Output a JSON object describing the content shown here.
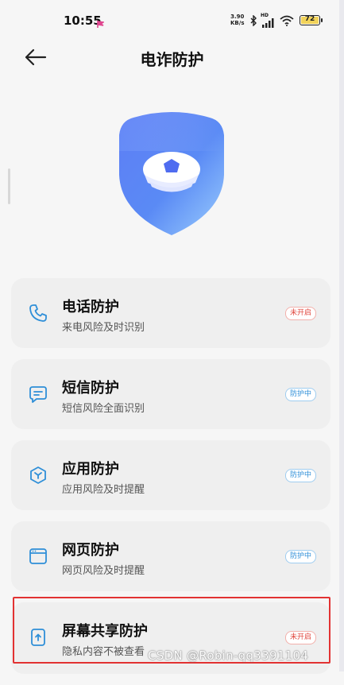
{
  "status_bar": {
    "time": "10:55",
    "net_speed_top": "3.90",
    "net_speed_bottom": "KB/s",
    "hd_label": "HD",
    "battery_level": "72"
  },
  "header": {
    "title": "电诈防护"
  },
  "cards": [
    {
      "name": "电话防护",
      "desc": "来电风险及时识别",
      "badge": "未开启",
      "state": "off",
      "icon": "phone-icon"
    },
    {
      "name": "短信防护",
      "desc": "短信风险全面识别",
      "badge": "防护中",
      "state": "on",
      "icon": "message-icon"
    },
    {
      "name": "应用防护",
      "desc": "应用风险及时提醒",
      "badge": "防护中",
      "state": "on",
      "icon": "app-icon"
    },
    {
      "name": "网页防护",
      "desc": "网页风险及时提醒",
      "badge": "防护中",
      "state": "on",
      "icon": "browser-icon"
    },
    {
      "name": "屏幕共享防护",
      "desc": "隐私内容不被查看",
      "badge": "未开启",
      "state": "off",
      "icon": "screen-share-icon"
    }
  ],
  "watermark": "CSDN @Robin-qq3391104",
  "colors": {
    "accent": "#2f8fd8",
    "off_red": "#e0463d",
    "highlight_border": "#e23232",
    "shield_top": "#4f6cf0",
    "shield_bottom": "#8fc3ff"
  }
}
